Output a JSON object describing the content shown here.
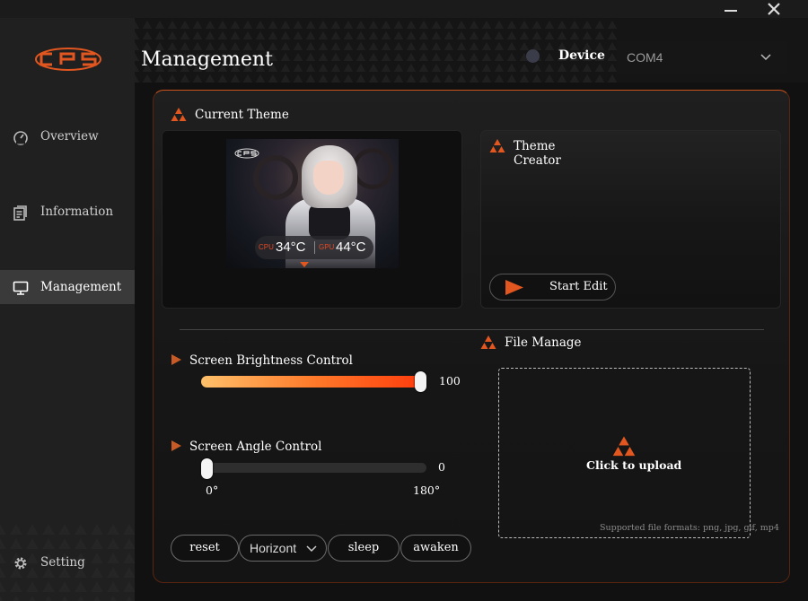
{
  "window": {
    "minimize_icon": "minimize-icon",
    "close_icon": "close-icon"
  },
  "brand": {
    "logo_text": "CPS",
    "accent_color": "#e2561f"
  },
  "sidebar": {
    "items": [
      {
        "label": "Overview",
        "icon": "speedometer-icon",
        "active": false
      },
      {
        "label": "Information",
        "icon": "document-icon",
        "active": false
      },
      {
        "label": "Management",
        "icon": "monitor-icon",
        "active": true
      }
    ],
    "setting": {
      "label": "Setting",
      "icon": "gear-icon"
    }
  },
  "header": {
    "title": "Management",
    "device_label": "Device",
    "device_value": "COM4"
  },
  "current_theme": {
    "label": "Current Theme",
    "preview": {
      "cpu_label": "CPU",
      "cpu_value": "34°C",
      "gpu_label": "GPU",
      "gpu_value": "44°C"
    }
  },
  "theme_creator": {
    "title_line1": "Theme",
    "title_line2": "Creator",
    "start_label": "Start Edit"
  },
  "brightness": {
    "label": "Screen Brightness Control",
    "value": "100",
    "fraction": 1.0
  },
  "angle": {
    "label": "Screen Angle Control",
    "value": "0",
    "min_label": "0°",
    "max_label": "180°",
    "fraction": 0.0
  },
  "file_manage": {
    "label": "File Manage",
    "upload_label": "Click to upload",
    "formats": "Supported file formats: png, jpg, gif, mp4"
  },
  "actions": {
    "reset": "reset",
    "orientation": "Horizont",
    "sleep": "sleep",
    "awaken": "awaken"
  }
}
